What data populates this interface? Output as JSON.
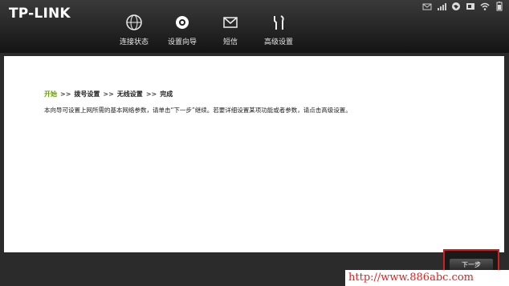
{
  "brand": {
    "logo_text": "TP-LINK"
  },
  "status_icons": [
    "mail-icon",
    "signal-icon",
    "globe-icon",
    "sim-icon",
    "wifi-icon",
    "battery-icon"
  ],
  "nav": [
    {
      "label": "连接状态",
      "icon": "globe-icon"
    },
    {
      "label": "设置向导",
      "icon": "gear-icon"
    },
    {
      "label": "短信",
      "icon": "envelope-icon"
    },
    {
      "label": "高级设置",
      "icon": "tools-icon"
    }
  ],
  "wizard": {
    "steps": [
      "开始",
      "拨号设置",
      "无线设置",
      "完成"
    ],
    "separator": ">>",
    "description": "本向导可设置上网所需的基本网络参数，请单击“下一步”继续。若要详细设置某项功能或者参数，请点击高级设置。",
    "next_label": "下一步"
  },
  "watermark": "http://www.886abc.com"
}
